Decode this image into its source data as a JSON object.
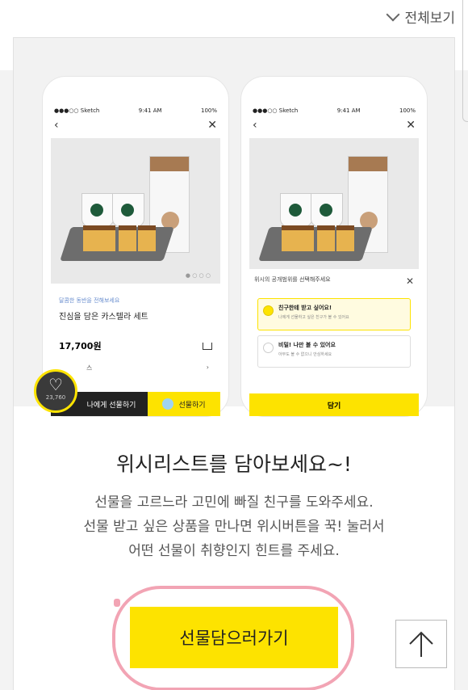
{
  "header": {
    "view_all": "전체보기"
  },
  "phone1": {
    "status_carrier": "●●●○○ Sketch",
    "status_time": "9:41 AM",
    "status_battery": "100%",
    "tag": "달콤한 동반을 전해보세요",
    "product_title": "진심을 담은 카스텔라 세트",
    "price": "17,700원",
    "row_text": "스",
    "btn_self": "나에게 선물하기",
    "btn_gift": "선물하기",
    "wish_count": "23,760"
  },
  "phone2": {
    "status_carrier": "●●●○○ Sketch",
    "status_time": "9:41 AM",
    "status_battery": "100%",
    "sheet_title": "위시의 공개범위를 선택해주세요",
    "option1_title": "친구한테 받고 싶어요!",
    "option1_sub": "나에게 선물하고 싶은 친구가 볼 수 있어요",
    "option2_title": "비밀! 나만 볼 수 있어요",
    "option2_sub": "아무도 볼 수 없으니 안심하세요",
    "confirm": "담기"
  },
  "main": {
    "headline": "위시리스트를 담아보세요~!",
    "desc_line1": "선물을 고르느라 고민에 빠질 친구를 도와주세요.",
    "desc_line2": "선물 받고 싶은 상품을 만나면 위시버튼을 꾹! 눌러서",
    "desc_line3": "어떤 선물이 취향인지 힌트를 주세요.",
    "cta": "선물담으러가기"
  },
  "colors": {
    "accent": "#fde300",
    "annotation": "#f2a4b4"
  }
}
